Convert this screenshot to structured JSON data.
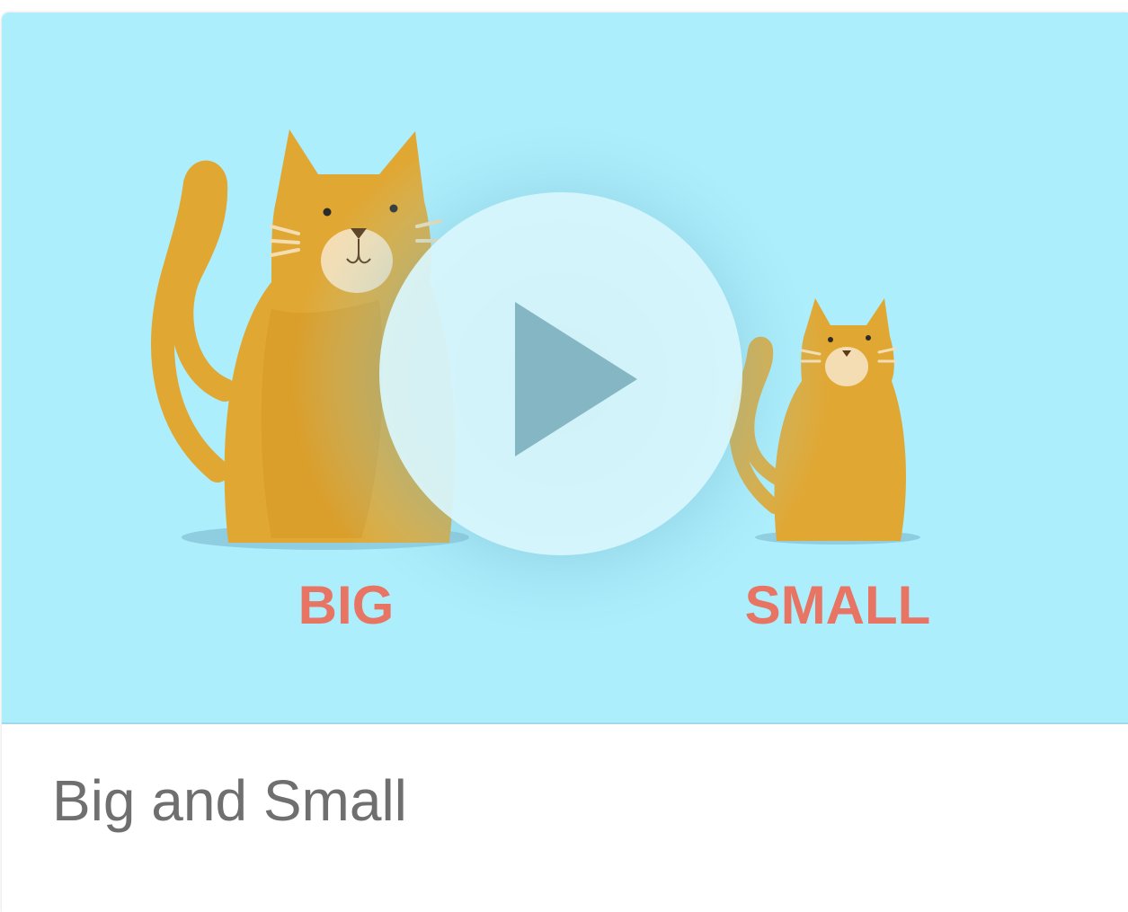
{
  "card": {
    "title": "Big and Small",
    "thumbnail": {
      "label_big": "BIG",
      "label_small": "SMALL"
    }
  },
  "colors": {
    "background_sky": "#aceefc",
    "cat": "#e0a733",
    "label": "#e87463",
    "play_circle": "#d9f6fd",
    "play_triangle": "#84b6c4",
    "title_text": "#6f6f6f"
  },
  "icons": {
    "play": "play-icon"
  }
}
